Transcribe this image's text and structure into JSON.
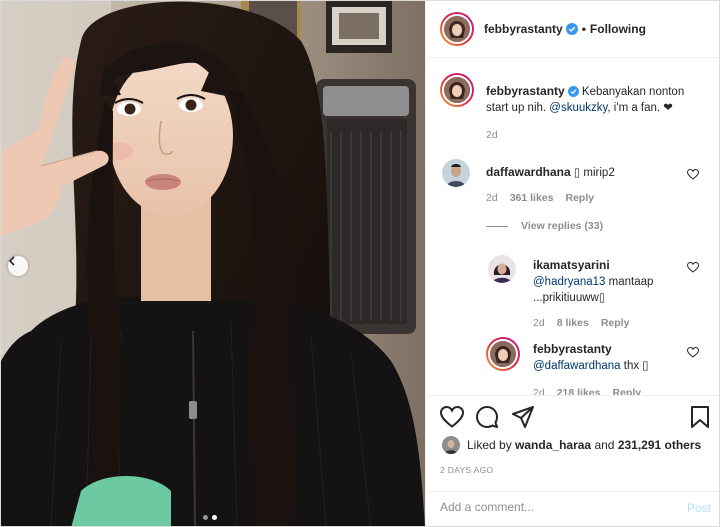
{
  "header": {
    "username": "febbyrastanty",
    "separator": "•",
    "follow_status": "Following"
  },
  "caption": {
    "username": "febbyrastanty",
    "text_before": "Kebanyakan nonton start up nih.",
    "mention": "@skuukzky",
    "text_after": ", i'm a fan. ❤",
    "time": "2d"
  },
  "comments": [
    {
      "username": "daffawardhana",
      "text": "▯ mirip2",
      "time": "2d",
      "likes": "361 likes",
      "reply": "Reply"
    }
  ],
  "view_replies": "View replies (33)",
  "replies": [
    {
      "username": "ikamatsyarini",
      "mention": "@hadryana13",
      "text": "mantaap",
      "text2": "...prikitiuuww▯",
      "time": "2d",
      "likes": "8 likes",
      "reply": "Reply"
    },
    {
      "username": "febbyrastanty",
      "mention": "@daffawardhana",
      "text": "thx ▯",
      "time": "2d",
      "likes": "218 likes",
      "reply": "Reply"
    }
  ],
  "likes_line": {
    "prefix": "Liked by",
    "user": "wanda_haraa",
    "middle": "and",
    "count": "231,291 others"
  },
  "timestamp": "2 DAYS AGO",
  "comment_input": {
    "placeholder": "Add a comment..."
  },
  "post_label": "Post",
  "colors": {
    "link": "#00376b",
    "verified": "#3897f0",
    "muted": "#8e8e8e",
    "post_disabled": "#b2dffc"
  },
  "icons": [
    "heart-icon",
    "comment-icon",
    "share-icon",
    "bookmark-icon",
    "verified-badge-icon",
    "chevron-left-icon"
  ]
}
